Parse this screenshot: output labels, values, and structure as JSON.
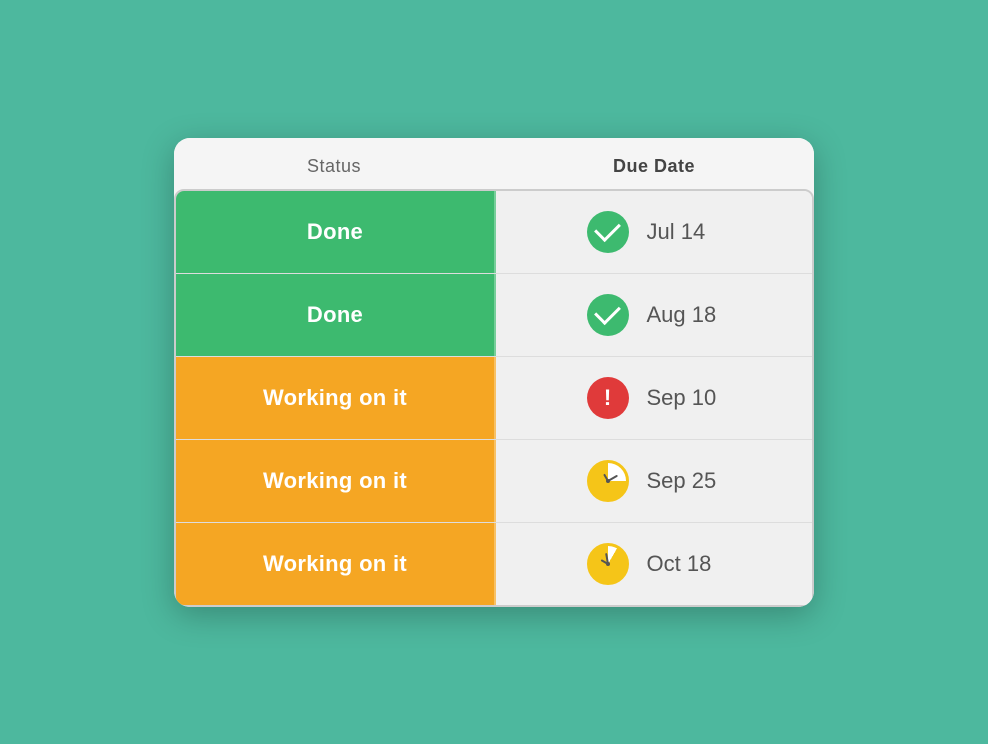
{
  "headers": {
    "status_label": "Status",
    "due_date_label": "Due Date"
  },
  "rows": [
    {
      "id": 1,
      "status": "Done",
      "status_type": "done",
      "icon_type": "check",
      "due_date": "Jul 14"
    },
    {
      "id": 2,
      "status": "Done",
      "status_type": "done",
      "icon_type": "check",
      "due_date": "Aug 18"
    },
    {
      "id": 3,
      "status": "Working on it",
      "status_type": "working",
      "icon_type": "alert",
      "due_date": "Sep 10"
    },
    {
      "id": 4,
      "status": "Working on it",
      "status_type": "working",
      "icon_type": "clock-75",
      "due_date": "Sep 25"
    },
    {
      "id": 5,
      "status": "Working on it",
      "status_type": "working",
      "icon_type": "clock-90",
      "due_date": "Oct 18"
    }
  ]
}
